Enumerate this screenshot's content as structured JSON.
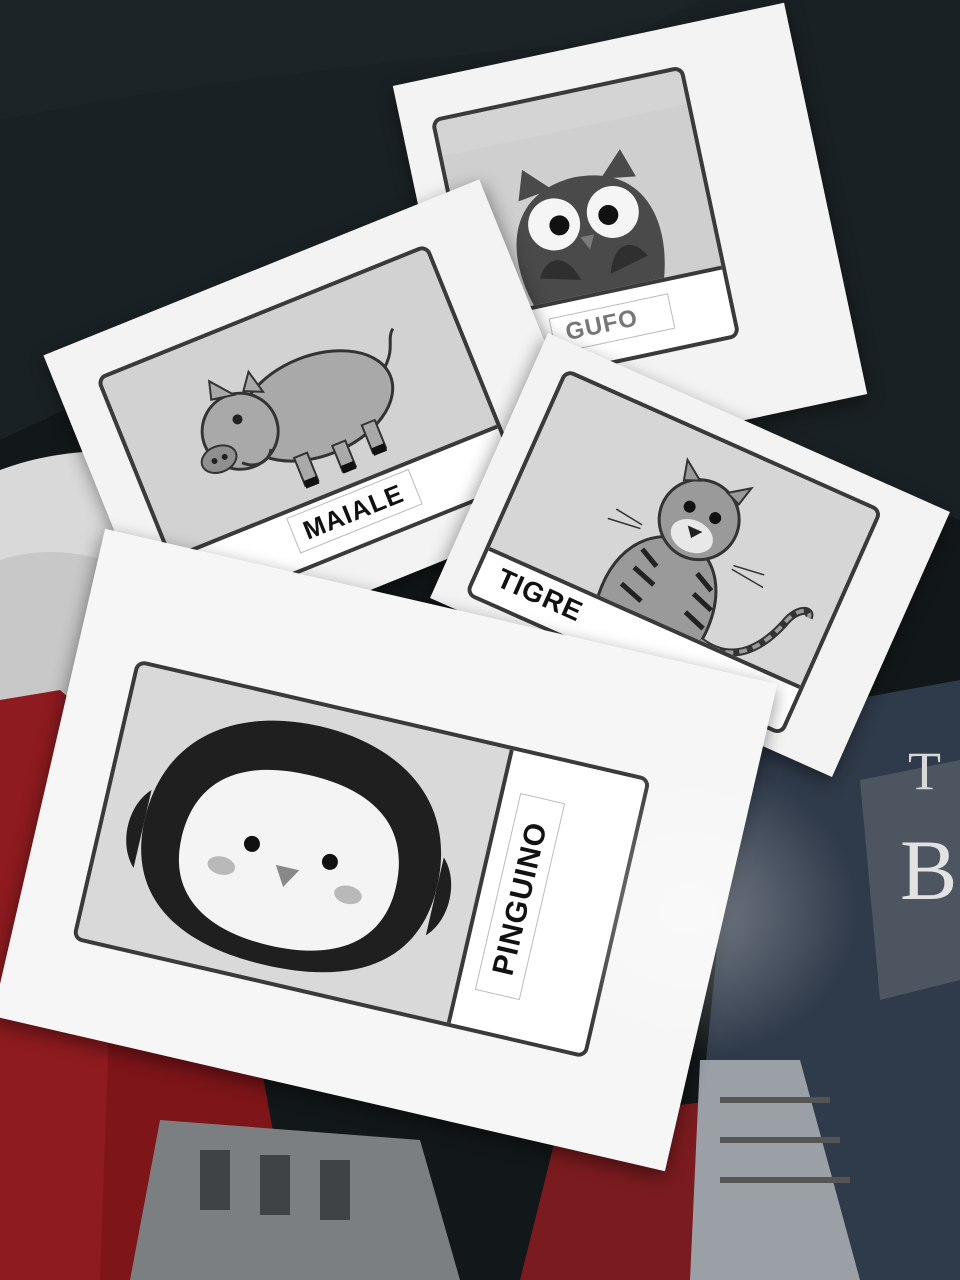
{
  "cards": {
    "owl": {
      "label": "GUFO"
    },
    "pig": {
      "label": "MAIALE"
    },
    "tiger": {
      "label": "TIGRE"
    },
    "penguin": {
      "label": "PINGUINO"
    }
  },
  "background": {
    "shirt_print_letters": [
      "T",
      "B"
    ]
  },
  "colors": {
    "blanket": "#14191d",
    "paper": "#f3f3f4",
    "card_fill": "#d4d4d4",
    "card_border": "#3a3a3a",
    "red_fabric": "#8e1b1f"
  }
}
